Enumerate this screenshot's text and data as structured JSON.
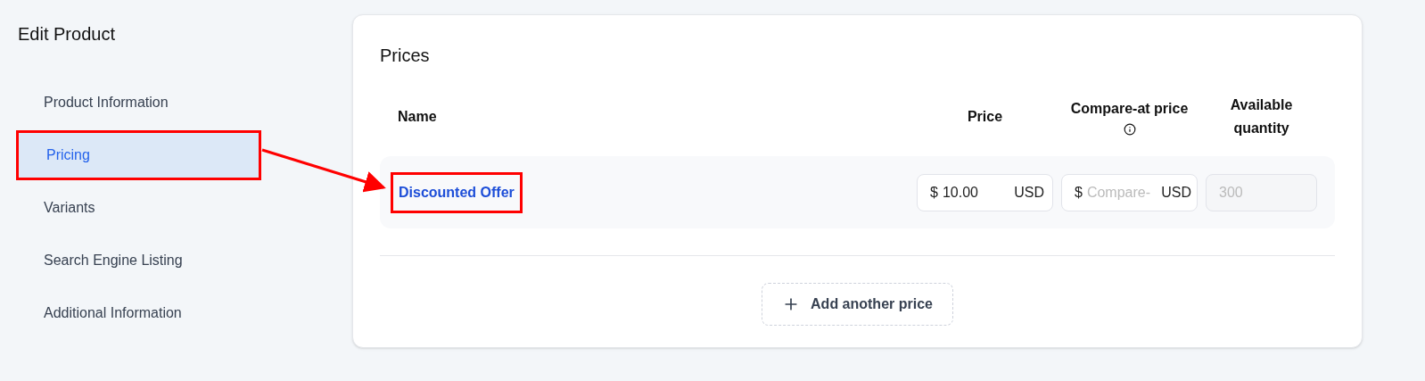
{
  "sidebar": {
    "title": "Edit Product",
    "items": [
      {
        "label": "Product Information",
        "selected": false,
        "outlined": false
      },
      {
        "label": "Pricing",
        "selected": true,
        "outlined": true
      },
      {
        "label": "Variants",
        "selected": false,
        "outlined": false
      },
      {
        "label": "Search Engine Listing",
        "selected": false,
        "outlined": false
      },
      {
        "label": "Additional Information",
        "selected": false,
        "outlined": false
      }
    ]
  },
  "annotation_arrow": true,
  "prices": {
    "title": "Prices",
    "columns": [
      "Name",
      "Price",
      "Compare-at price",
      "Available quantity"
    ],
    "rows": [
      {
        "name": "Discounted Offer",
        "outlined": true,
        "price": {
          "prefix": "$",
          "value": "10.00",
          "suffix": "USD"
        },
        "compare_at": {
          "prefix": "$",
          "placeholder": "Compare-",
          "suffix": "USD"
        },
        "quantity": {
          "placeholder": "300"
        }
      }
    ],
    "add_button": "Add another price"
  }
}
